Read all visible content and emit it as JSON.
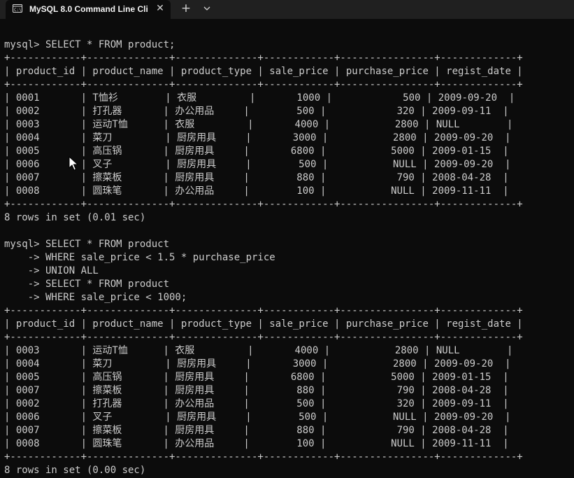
{
  "window": {
    "tab_title": "MySQL 8.0 Command Line Cli",
    "tab_icon": "console-icon",
    "close_glyph": "✕",
    "new_tab_glyph": "+",
    "dropdown_icon": "chevron-down-icon"
  },
  "colors": {
    "background": "#0c0c0c",
    "titlebar": "#202020",
    "text": "#cccccc"
  },
  "terminal": {
    "lines": [
      "mysql> SELECT * FROM product;",
      "+------------+--------------+--------------+------------+----------------+-------------+",
      "| product_id | product_name | product_type | sale_price | purchase_price | regist_date |",
      "+------------+--------------+--------------+------------+----------------+-------------+",
      "| 0001       | T恤衫        | 衣服         |       1000 |            500 | 2009-09-20  |",
      "| 0002       | 打孔器       | 办公用品     |        500 |            320 | 2009-09-11  |",
      "| 0003       | 运动T恤      | 衣服         |       4000 |           2800 | NULL        |",
      "| 0004       | 菜刀         | 厨房用具     |       3000 |           2800 | 2009-09-20  |",
      "| 0005       | 高压锅       | 厨房用具     |       6800 |           5000 | 2009-01-15  |",
      "| 0006       | 叉子         | 厨房用具     |        500 |           NULL | 2009-09-20  |",
      "| 0007       | 擦菜板       | 厨房用具     |        880 |            790 | 2008-04-28  |",
      "| 0008       | 圆珠笔       | 办公用品     |        100 |           NULL | 2009-11-11  |",
      "+------------+--------------+--------------+------------+----------------+-------------+",
      "8 rows in set (0.01 sec)",
      "",
      "mysql> SELECT * FROM product",
      "    -> WHERE sale_price < 1.5 * purchase_price",
      "    -> UNION ALL",
      "    -> SELECT * FROM product",
      "    -> WHERE sale_price < 1000;",
      "+------------+--------------+--------------+------------+----------------+-------------+",
      "| product_id | product_name | product_type | sale_price | purchase_price | regist_date |",
      "+------------+--------------+--------------+------------+----------------+-------------+",
      "| 0003       | 运动T恤      | 衣服         |       4000 |           2800 | NULL        |",
      "| 0004       | 菜刀         | 厨房用具     |       3000 |           2800 | 2009-09-20  |",
      "| 0005       | 高压锅       | 厨房用具     |       6800 |           5000 | 2009-01-15  |",
      "| 0007       | 擦菜板       | 厨房用具     |        880 |            790 | 2008-04-28  |",
      "| 0002       | 打孔器       | 办公用品     |        500 |            320 | 2009-09-11  |",
      "| 0006       | 叉子         | 厨房用具     |        500 |           NULL | 2009-09-20  |",
      "| 0007       | 擦菜板       | 厨房用具     |        880 |            790 | 2008-04-28  |",
      "| 0008       | 圆珠笔       | 办公用品     |        100 |           NULL | 2009-11-11  |",
      "+------------+--------------+--------------+------------+----------------+-------------+",
      "8 rows in set (0.00 sec)"
    ]
  }
}
